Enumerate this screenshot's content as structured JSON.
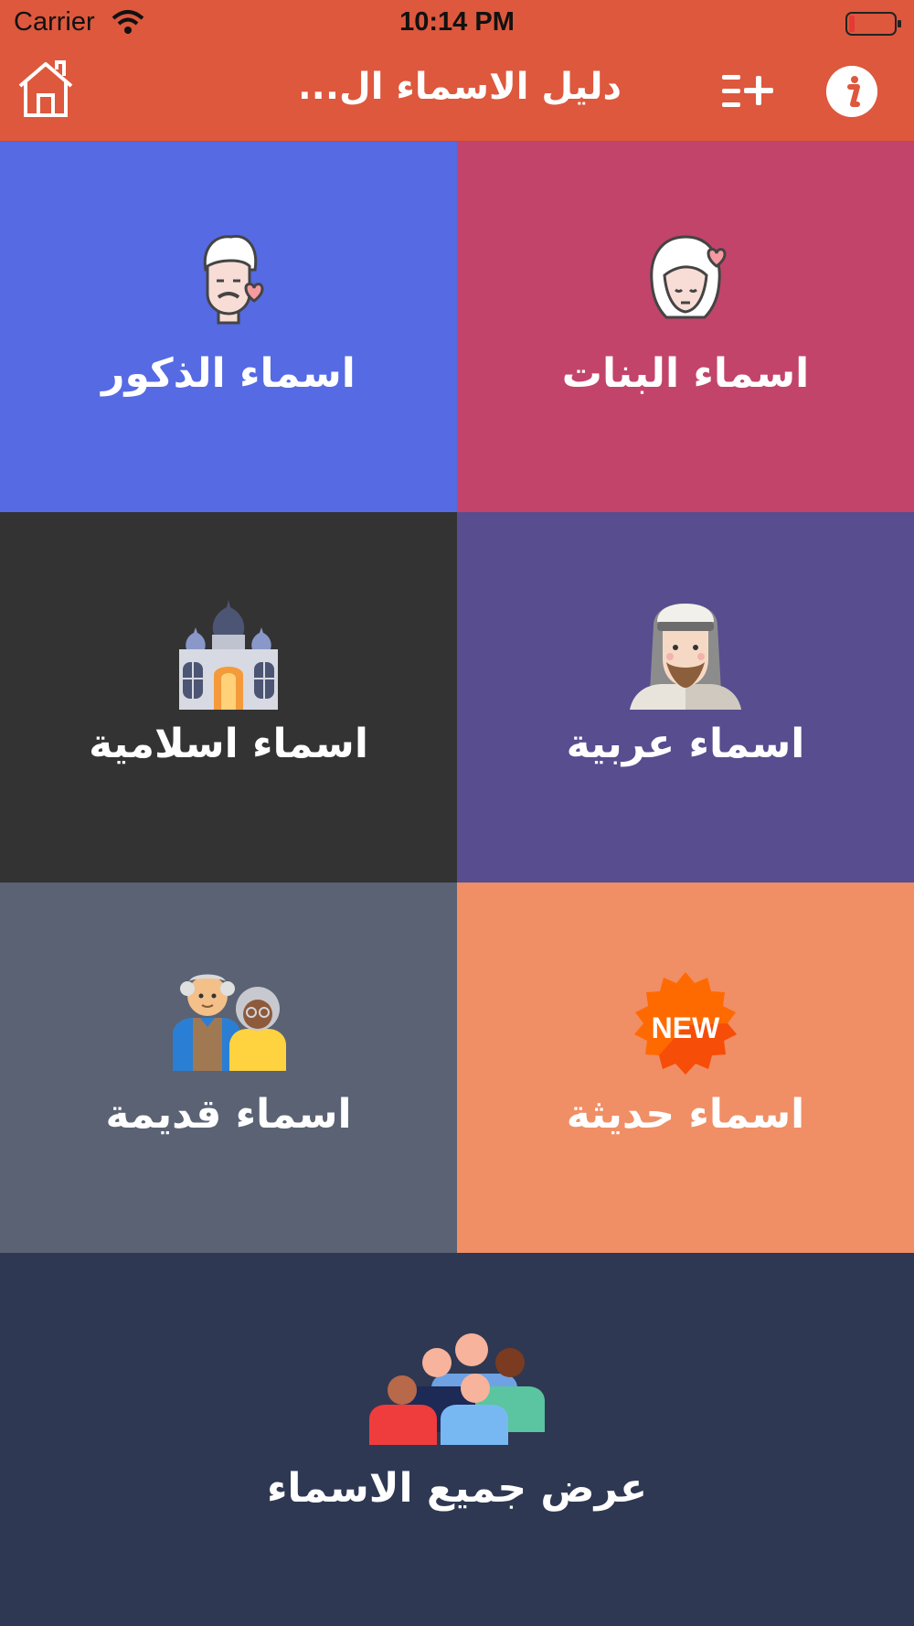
{
  "status": {
    "carrier": "Carrier",
    "time": "10:14 PM"
  },
  "nav": {
    "title": "دليل الاسماء ال...",
    "home_icon": "home-icon",
    "add_icon": "list-add-icon",
    "info_icon": "info-icon",
    "bar_color": "#dd583d"
  },
  "tiles": [
    {
      "label": "اسماء البنات",
      "color": "#c2446a",
      "icon": "girl-avatar-icon"
    },
    {
      "label": "اسماء الذكور",
      "color": "#556ae3",
      "icon": "man-avatar-icon"
    },
    {
      "label": "اسماء عربية",
      "color": "#574d8f",
      "icon": "arab-man-icon"
    },
    {
      "label": "اسماء اسلامية",
      "color": "#333333",
      "icon": "mosque-icon"
    },
    {
      "label": "اسماء حديثة",
      "color": "#f08e66",
      "icon": "new-badge-icon"
    },
    {
      "label": "اسماء قديمة",
      "color": "#5a6274",
      "icon": "elderly-couple-icon"
    }
  ],
  "new_badge_text": "NEW",
  "all_names": {
    "label": "عرض جميع الاسماء",
    "color": "#2e3852",
    "icon": "group-people-icon"
  }
}
